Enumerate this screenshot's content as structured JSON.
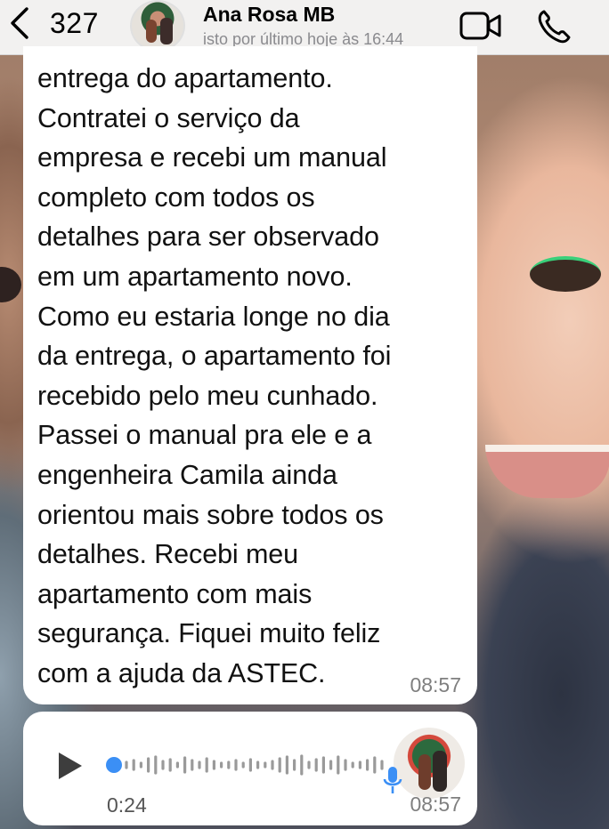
{
  "header": {
    "back_count": "327",
    "contact_name": "Ana Rosa MB",
    "status": "isto por último hoje às 16:44",
    "icons": [
      "chevron-left-icon",
      "video-call-icon",
      "phone-icon"
    ]
  },
  "message": {
    "text": "entrega do apartamento.\nContratei o serviço da\nempresa e recebi um manual\ncompleto com todos os\ndetalhes para ser observado\nem um apartamento novo.\nComo eu estaria longe no dia\nda entrega, o apartamento foi\nrecebido pelo meu cunhado.\nPassei o manual pra ele e a\nengenheira Camila ainda\norientou mais sobre todos os\ndetalhes.  Recebi meu\napartamento com mais\nsegurança.  Fiquei muito feliz\ncom a ajuda da ASTEC.",
    "time": "08:57"
  },
  "voice_message": {
    "duration": "0:24",
    "time": "08:57",
    "progress": 0,
    "accent_color": "#3b8ff5"
  },
  "colors": {
    "bubble": "#ffffff",
    "header_bg": "#f6f6f6",
    "timestamp": "#7f7f7f"
  }
}
